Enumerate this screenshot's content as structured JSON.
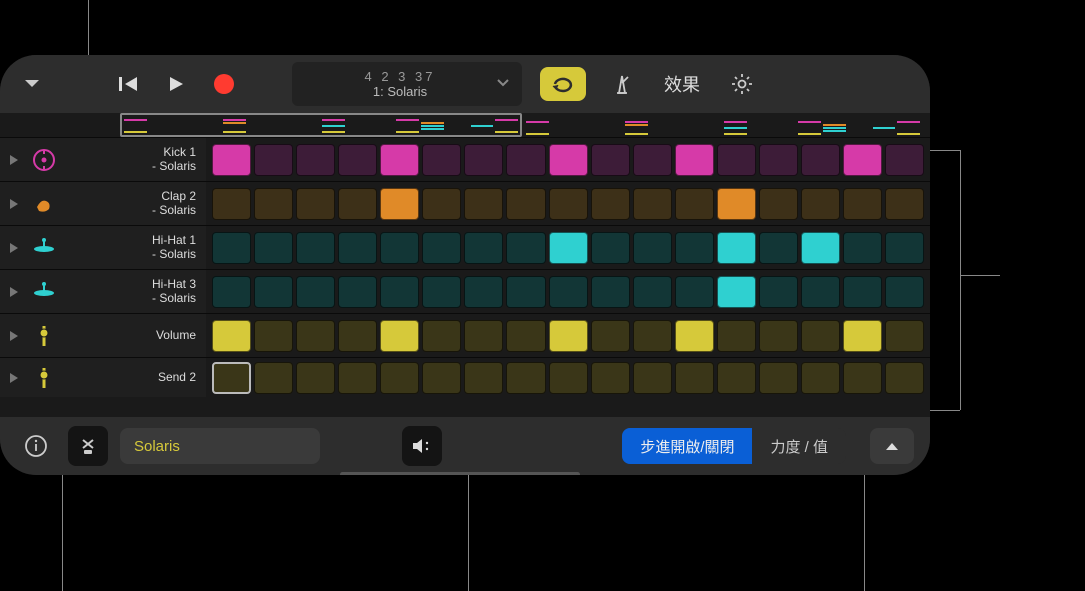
{
  "toolbar": {
    "lcd_row1": "4  2  3   37",
    "lcd_row2": "1: Solaris",
    "effects_label": "效果"
  },
  "tracks": [
    {
      "name_line1": "Kick 1",
      "name_line2": "- Solaris",
      "icon": "kick",
      "icon_color": "#d63aa8",
      "active_color": "#d63aa8",
      "dim_color": "#3d1c38",
      "steps": [
        1,
        0,
        0,
        0,
        1,
        0,
        0,
        0,
        1,
        0,
        0,
        1,
        0,
        0,
        0,
        1,
        0
      ]
    },
    {
      "name_line1": "Clap 2",
      "name_line2": "- Solaris",
      "icon": "clap",
      "icon_color": "#e08a28",
      "active_color": "#e08a28",
      "dim_color": "#3d3018",
      "steps": [
        0,
        0,
        0,
        0,
        1,
        0,
        0,
        0,
        0,
        0,
        0,
        0,
        1,
        0,
        0,
        0,
        0
      ]
    },
    {
      "name_line1": "Hi-Hat 1",
      "name_line2": "- Solaris",
      "icon": "hihat",
      "icon_color": "#2fd0d0",
      "active_color": "#2fd0d0",
      "dim_color": "#123636",
      "steps": [
        0,
        0,
        0,
        0,
        0,
        0,
        0,
        0,
        1,
        0,
        0,
        0,
        1,
        0,
        1,
        0,
        0
      ]
    },
    {
      "name_line1": "Hi-Hat 3",
      "name_line2": "- Solaris",
      "icon": "hihat",
      "icon_color": "#2fd0d0",
      "active_color": "#2fd0d0",
      "dim_color": "#123636",
      "steps": [
        0,
        0,
        0,
        0,
        0,
        0,
        0,
        0,
        0,
        0,
        0,
        0,
        1,
        0,
        0,
        0,
        0
      ]
    },
    {
      "name_line1": "Volume",
      "name_line2": "",
      "icon": "slider",
      "icon_color": "#d6c93a",
      "active_color": "#d6c93a",
      "dim_color": "#3a3618",
      "steps": [
        1,
        0,
        0,
        0,
        1,
        0,
        0,
        0,
        1,
        0,
        0,
        1,
        0,
        0,
        0,
        1,
        0
      ]
    },
    {
      "name_line1": "Send 2",
      "name_line2": "",
      "icon": "slider",
      "icon_color": "#d6c93a",
      "active_color": "#d6c93a",
      "dim_color": "#3a3618",
      "steps": [
        0,
        0,
        0,
        0,
        0,
        0,
        0,
        0,
        0,
        0,
        0,
        0,
        0,
        0,
        0,
        0,
        0
      ],
      "selected_step": 0,
      "short": true
    }
  ],
  "bottom": {
    "kit_name": "Solaris",
    "mode_active": "步進開啟/關閉",
    "mode_inactive": "力度 / 值"
  }
}
